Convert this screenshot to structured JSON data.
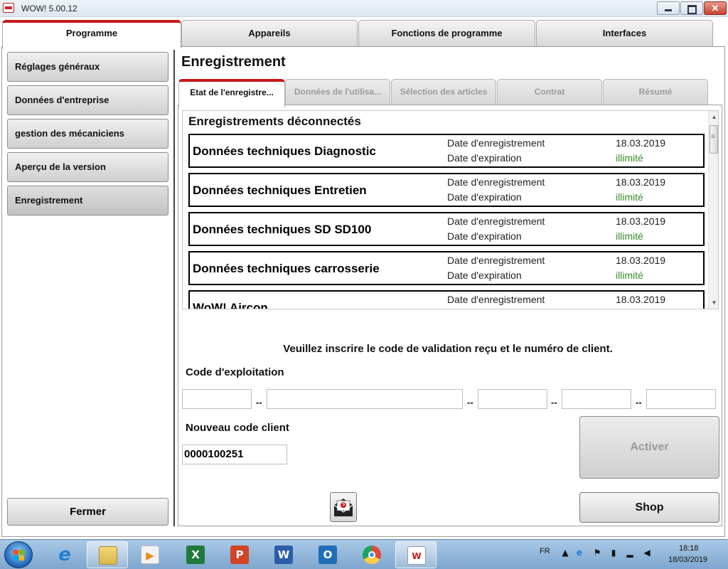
{
  "window": {
    "title": "WOW! 5.00.12"
  },
  "top_tabs": [
    {
      "label": "Programme"
    },
    {
      "label": "Appareils"
    },
    {
      "label": "Fonctions de programme"
    },
    {
      "label": "Interfaces"
    }
  ],
  "sidebar": {
    "items": [
      {
        "label": "Réglages généraux"
      },
      {
        "label": "Données d'entreprise"
      },
      {
        "label": "gestion des mécaniciens"
      },
      {
        "label": "Aperçu de la version"
      },
      {
        "label": "Enregistrement"
      }
    ],
    "close_label": "Fermer"
  },
  "section_title": "Enregistrement",
  "inner_tabs": [
    {
      "label": "Etat de l'enregistre..."
    },
    {
      "label": "Données de l'utilisa..."
    },
    {
      "label": "Sélection des articles"
    },
    {
      "label": "Contrat"
    },
    {
      "label": "Résumé"
    }
  ],
  "registrations": {
    "heading": "Enregistrements déconnectés",
    "label_registered": "Date d'enregistrement",
    "label_expiry": "Date d'expiration",
    "rows": [
      {
        "name": "Données techniques Diagnostic",
        "registered": "18.03.2019",
        "expiry": "illimité"
      },
      {
        "name": "Données techniques Entretien",
        "registered": "18.03.2019",
        "expiry": "illimité"
      },
      {
        "name": "Données techniques SD SD100",
        "registered": "18.03.2019",
        "expiry": "illimité"
      },
      {
        "name": "Données techniques carrosserie",
        "registered": "18.03.2019",
        "expiry": "illimité"
      },
      {
        "name": "WoW! Aircon",
        "registered": "18.03.2019",
        "expiry": ""
      }
    ]
  },
  "form": {
    "instruction": "Veuillez inscrire le code de validation reçu et le numéro de client.",
    "code_label": "Code d'exploitation",
    "code_separator": "--",
    "code_fields": [
      "",
      "",
      "",
      "",
      ""
    ],
    "client_label": "Nouveau code client",
    "client_value": "0000100251",
    "activate_label": "Activer",
    "shop_label": "Shop"
  },
  "taskbar": {
    "language": "FR",
    "time": "18:18",
    "date": "18/03/2019",
    "apps": [
      {
        "name": "internet-explorer",
        "glyph": "e",
        "color": "#1f7fd6"
      },
      {
        "name": "file-explorer",
        "glyph": "",
        "color": "#d9b64a"
      },
      {
        "name": "media-player",
        "glyph": "▶",
        "color": "#e58a1f"
      },
      {
        "name": "excel",
        "glyph": "X",
        "color": "#1f7a3c"
      },
      {
        "name": "powerpoint",
        "glyph": "P",
        "color": "#d04423"
      },
      {
        "name": "word",
        "glyph": "W",
        "color": "#2b5ca8"
      },
      {
        "name": "outlook",
        "glyph": "O",
        "color": "#1f6fb8"
      },
      {
        "name": "chrome",
        "glyph": "",
        "color": "#dd4b39"
      },
      {
        "name": "wow-app",
        "glyph": "W",
        "color": "#ffffff"
      }
    ]
  }
}
